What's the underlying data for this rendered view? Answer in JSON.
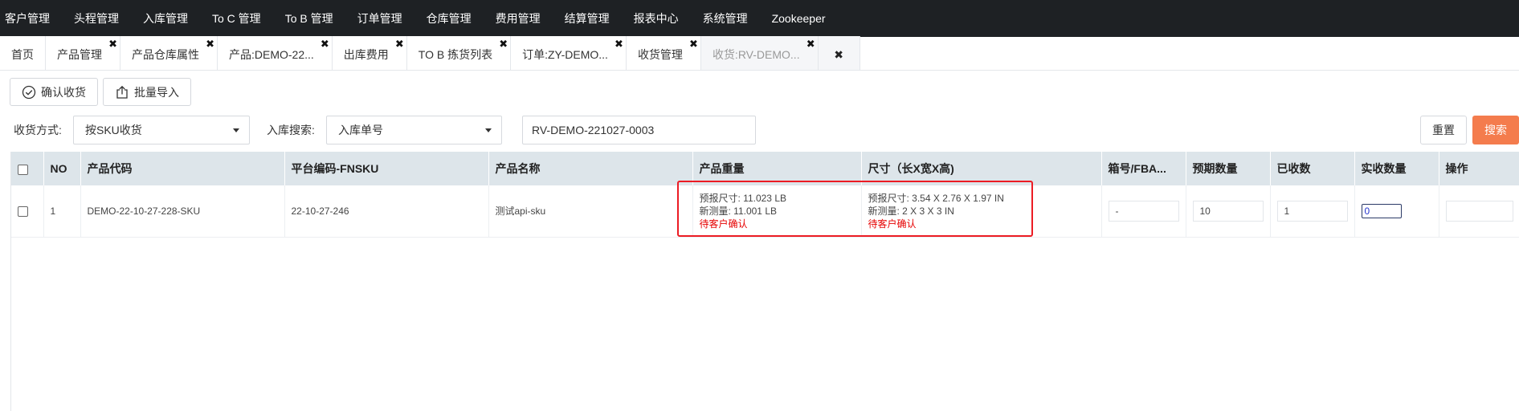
{
  "nav": {
    "items": [
      "客户管理",
      "头程管理",
      "入库管理",
      "To C 管理",
      "To B 管理",
      "订单管理",
      "仓库管理",
      "费用管理",
      "结算管理",
      "报表中心",
      "系统管理",
      "Zookeeper"
    ]
  },
  "tabs": [
    {
      "label": "首页",
      "closable": false,
      "active": false
    },
    {
      "label": "产品管理",
      "closable": true,
      "active": false
    },
    {
      "label": "产品仓库属性",
      "closable": true,
      "active": false
    },
    {
      "label": "产品:DEMO-22...",
      "closable": true,
      "active": false
    },
    {
      "label": "出库费用",
      "closable": true,
      "active": false
    },
    {
      "label": "TO B 拣货列表",
      "closable": true,
      "active": false
    },
    {
      "label": "订单:ZY-DEMO...",
      "closable": true,
      "active": false
    },
    {
      "label": "收货管理",
      "closable": true,
      "active": false
    },
    {
      "label": "收货:RV-DEMO...",
      "closable": true,
      "active": true
    }
  ],
  "tab_close_glyph": "✖",
  "toolbar": {
    "confirm_label": "确认收货",
    "import_label": "批量导入"
  },
  "search": {
    "mode_label": "收货方式:",
    "mode_value": "按SKU收货",
    "field_label": "入库搜索:",
    "field_value": "入库单号",
    "query_value": "RV-DEMO-221027-0003",
    "reset_label": "重置",
    "search_label": "搜索"
  },
  "table": {
    "headers": [
      "NO",
      "产品代码",
      "平台编码-FNSKU",
      "产品名称",
      "产品重量",
      "尺寸（长X宽X高)",
      "箱号/FBA...",
      "预期数量",
      "已收数",
      "实收数量",
      "操作"
    ],
    "rows": [
      {
        "no": "1",
        "code": "DEMO-22-10-27-228-SKU",
        "fnsku": "22-10-27-246",
        "name": "测试api-sku",
        "weight_reported": "预报尺寸: 11.023 LB",
        "weight_measured": "新测量: 11.001 LB",
        "weight_status": "待客户确认",
        "size_reported": "预报尺寸: 3.54 X 2.76 X 1.97 IN",
        "size_measured": "新测量: 2 X 3 X 3 IN",
        "size_status": "待客户确认",
        "box_no": "-",
        "expected_qty": "10",
        "received_qty": "1",
        "actual_qty": "0"
      }
    ]
  },
  "colors": {
    "nav_bg": "#1e2124",
    "search_button": "#f47c4d",
    "status_red": "#e60000",
    "highlight_border": "#ec1c24"
  }
}
